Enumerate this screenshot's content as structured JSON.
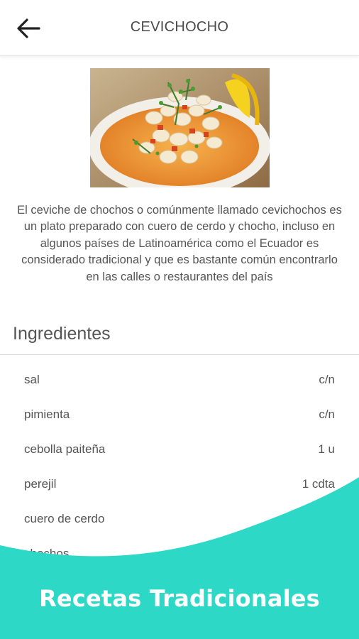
{
  "header": {
    "title": "CEVICHOCHO",
    "back_icon": "arrow-left-icon"
  },
  "recipe": {
    "image_alt": "ceviche de chochos dish",
    "description": "El ceviche de chochos o comúnmente llamado cevichochos es un plato preparado con cuero de cerdo y chocho, incluso en algunos países de Latinoamérica como el Ecuador es considerado tradicional y que es bastante común encontrarlo en las calles o restaurantes del país"
  },
  "ingredients": {
    "title": "Ingredientes",
    "items": [
      {
        "name": "sal",
        "qty": "c/n"
      },
      {
        "name": "pimienta",
        "qty": "c/n"
      },
      {
        "name": "cebolla paiteña",
        "qty": "1 u"
      },
      {
        "name": "perejil",
        "qty": "1 cdta"
      },
      {
        "name": "cuero de cerdo",
        "qty": ""
      },
      {
        "name": "chochos",
        "qty": ""
      }
    ]
  },
  "banner": {
    "text": "Recetas Tradicionales",
    "color": "#2ED8C6"
  }
}
